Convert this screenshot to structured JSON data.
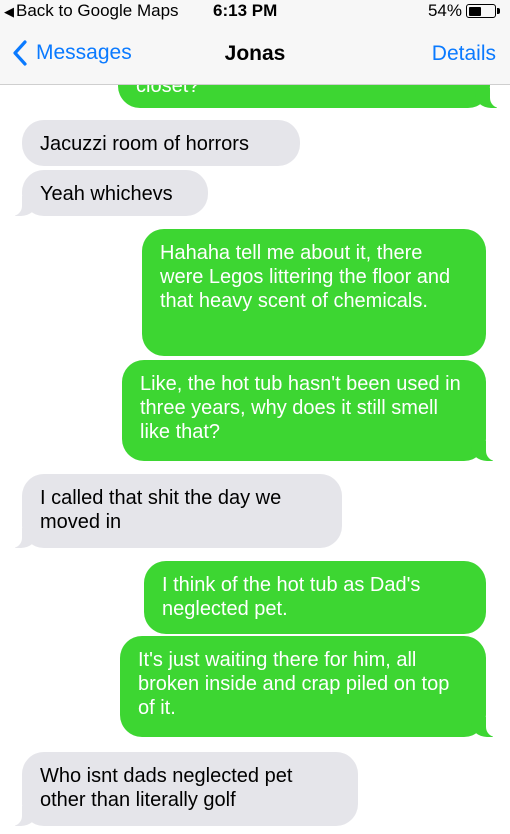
{
  "status_bar": {
    "back_app": "Back to Google Maps",
    "time": "6:13 PM",
    "battery": "54%",
    "battery_level": 0.54
  },
  "nav": {
    "back_label": "Messages",
    "title": "Jonas",
    "details_label": "Details"
  },
  "messages": [
    {
      "direction": "outgoing",
      "text": "closet?"
    },
    {
      "direction": "incoming",
      "text": "Jacuzzi room of horrors"
    },
    {
      "direction": "incoming",
      "text": "Yeah whichevs"
    },
    {
      "direction": "outgoing",
      "text": "Hahaha tell me about it, there were Legos littering the floor and that heavy scent of chemicals."
    },
    {
      "direction": "outgoing",
      "text": "Like, the hot tub hasn't been used in three years, why does it still smell like that?"
    },
    {
      "direction": "incoming",
      "text": "I called that shit the day we moved in"
    },
    {
      "direction": "outgoing",
      "text": "I think of the hot tub as Dad's neglected pet."
    },
    {
      "direction": "outgoing",
      "text": "It's just waiting there for him, all broken inside and crap piled on top of it."
    },
    {
      "direction": "incoming",
      "text": "Who isnt dads neglected pet other than literally golf"
    }
  ]
}
